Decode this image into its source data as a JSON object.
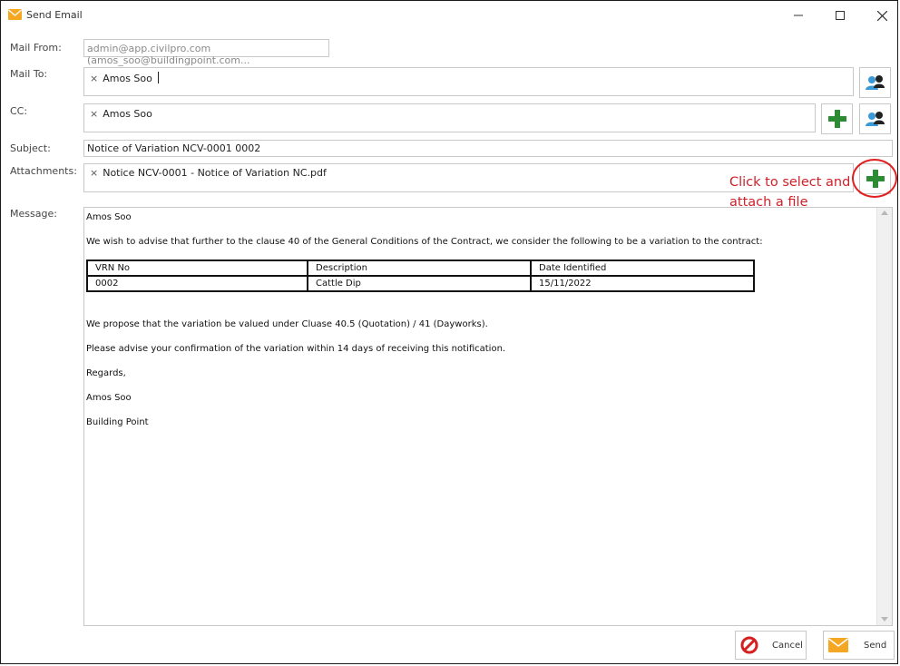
{
  "window": {
    "title": "Send Email"
  },
  "labels": {
    "mail_from": "Mail From:",
    "mail_to": "Mail To:",
    "cc": "CC:",
    "subject": "Subject:",
    "attachments": "Attachments:",
    "message": "Message:"
  },
  "fields": {
    "mail_from": "admin@app.civilpro.com (amos_soo@buildingpoint.com...",
    "mail_to_recipients": [
      "Amos Soo"
    ],
    "cc_recipients": [
      "Amos Soo"
    ],
    "subject": "Notice of Variation NCV-0001 0002",
    "attachments": [
      "Notice NCV-0001 - Notice of Variation NC.pdf"
    ]
  },
  "chip_remove_glyph": "×",
  "annotation": {
    "line1": "Click to select and",
    "line2": "attach a file"
  },
  "message": {
    "greeting": "Amos Soo",
    "intro": "We wish to advise that further to the clause 40 of the General Conditions of the Contract, we consider the following to be a variation to the contract:",
    "table": {
      "headers": [
        "VRN No",
        "Description",
        "Date Identified"
      ],
      "rows": [
        [
          "0002",
          "Cattle Dip",
          "15/11/2022"
        ]
      ]
    },
    "proposal": "We propose that the variation be valued under Cluase 40.5 (Quotation) / 41 (Dayworks).",
    "advise": "Please advise your confirmation of the variation within 14 days of receiving this notification.",
    "regards": "Regards,",
    "signature_name": "Amos Soo",
    "signature_company": "Building Point"
  },
  "buttons": {
    "cancel": "Cancel",
    "send": "Send"
  },
  "colors": {
    "accent_green": "#2e8b35",
    "annotation_red": "#d0212a",
    "envelope_orange": "#f5a623",
    "contacts_blue": "#3a9ad9",
    "cancel_red": "#d62020"
  }
}
